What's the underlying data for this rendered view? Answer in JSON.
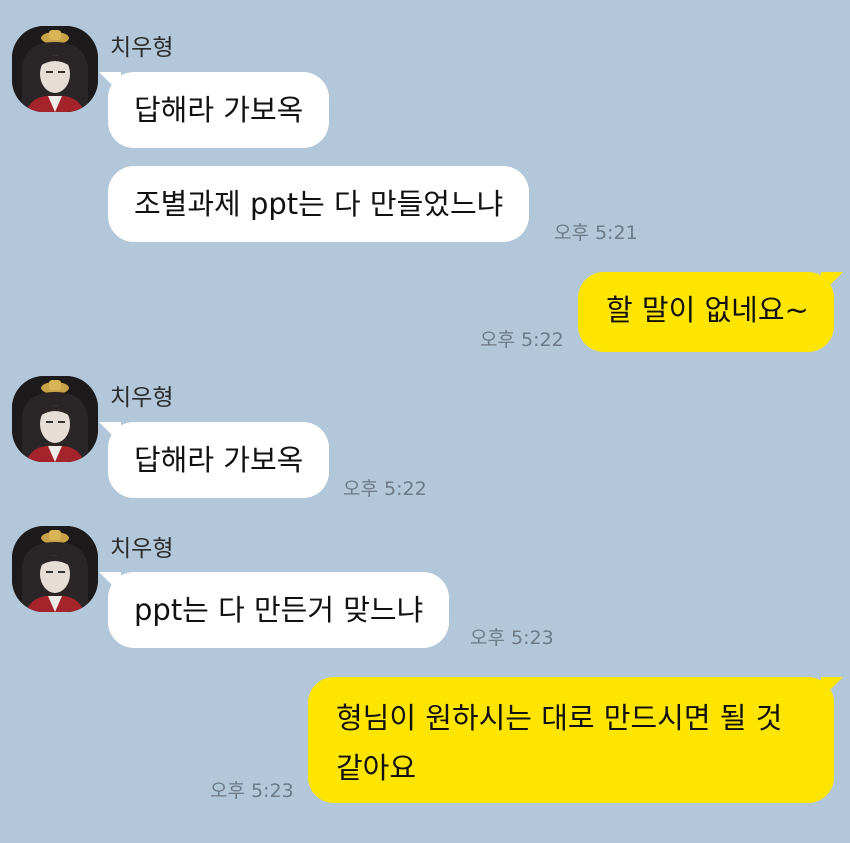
{
  "theme": {
    "background": "#b2c7da",
    "incoming_bubble": "#ffffff",
    "outgoing_bubble": "#fee500",
    "time_color": "#6d7a87"
  },
  "messages": [
    {
      "sender": "치우형",
      "text": "답해라 가보옥"
    },
    {
      "text": "조별과제 ppt는 다 만들었느냐",
      "time": "오후 5:21"
    },
    {
      "text": "할 말이 없네요~",
      "time": "오후 5:22",
      "outgoing": true
    },
    {
      "sender": "치우형",
      "text": "답해라 가보옥",
      "time": "오후 5:22"
    },
    {
      "sender": "치우형",
      "text": "ppt는 다 만든거 맞느냐",
      "time": "오후 5:23"
    },
    {
      "text": "형님이 원하시는 대로 만드시면 될 것 같아요",
      "time": "오후 5:23",
      "outgoing": true
    }
  ]
}
